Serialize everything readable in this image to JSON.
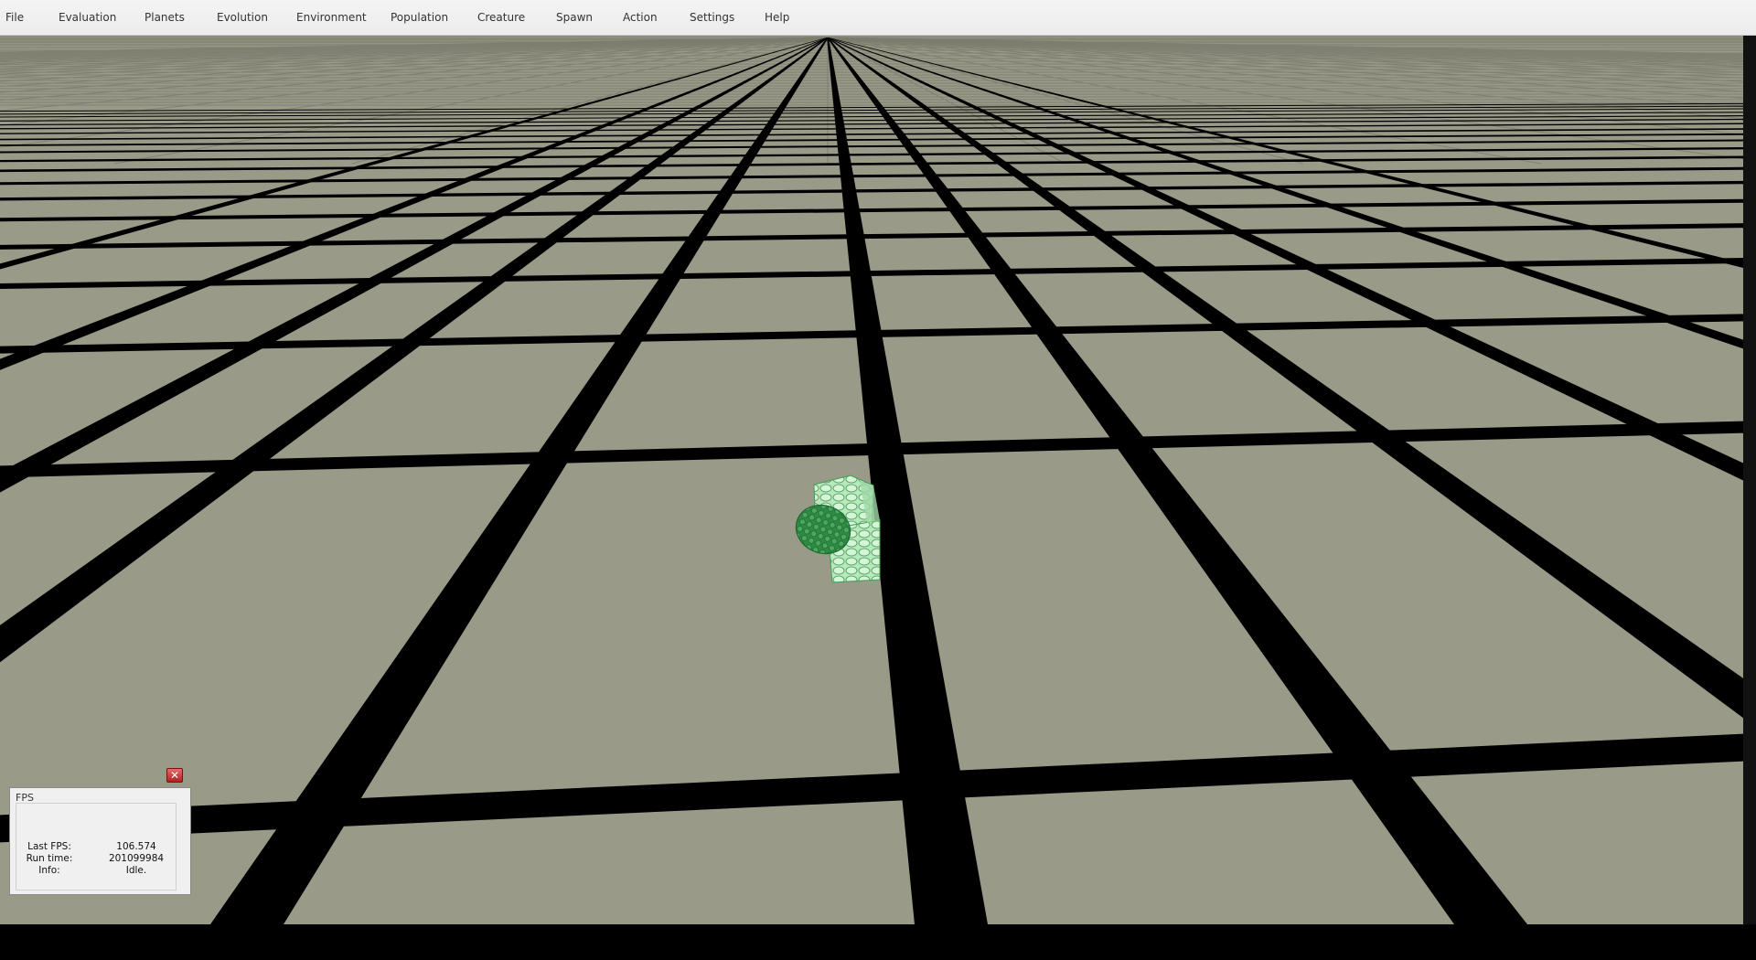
{
  "menu": {
    "items": [
      "File",
      "Evaluation",
      "Planets",
      "Evolution",
      "Environment",
      "Population",
      "Creature",
      "Spawn",
      "Action",
      "Settings",
      "Help"
    ]
  },
  "fps_window": {
    "title": "FPS",
    "close_icon": "close-icon",
    "rows": [
      {
        "label": "Last FPS:",
        "value": "106.574"
      },
      {
        "label": "Run time:",
        "value": "201099984"
      },
      {
        "label": "Info:",
        "value": "Idle."
      }
    ]
  },
  "scene": {
    "floor_color": "#9a9a88",
    "grid_line_color": "#000000",
    "creature_color": "#7ad889"
  }
}
